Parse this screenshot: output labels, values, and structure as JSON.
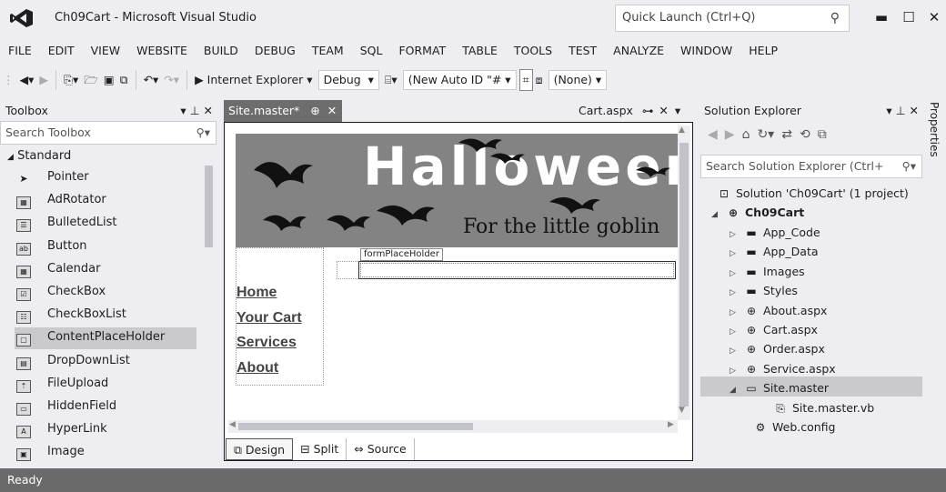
{
  "window": {
    "title": "Ch09Cart - Microsoft Visual Studio",
    "quick_launch": "Quick Launch (Ctrl+Q)"
  },
  "menu": [
    "FILE",
    "EDIT",
    "VIEW",
    "WEBSITE",
    "BUILD",
    "DEBUG",
    "TEAM",
    "SQL",
    "FORMAT",
    "TABLE",
    "TOOLS",
    "TEST",
    "ANALYZE",
    "WINDOW",
    "HELP"
  ],
  "toolbar": {
    "browser": "Internet Explorer",
    "config": "Debug",
    "auto_id": "(New Auto ID \"#",
    "none": "(None)"
  },
  "toolbox": {
    "title": "Toolbox",
    "search_placeholder": "Search Toolbox",
    "group": "Standard",
    "items": [
      {
        "label": "Pointer",
        "icon": "pointer-icon"
      },
      {
        "label": "AdRotator",
        "icon": "adrotator-icon"
      },
      {
        "label": "BulletedList",
        "icon": "bulleted-list-icon"
      },
      {
        "label": "Button",
        "icon": "button-icon"
      },
      {
        "label": "Calendar",
        "icon": "calendar-icon"
      },
      {
        "label": "CheckBox",
        "icon": "checkbox-icon"
      },
      {
        "label": "CheckBoxList",
        "icon": "checkbox-list-icon"
      },
      {
        "label": "ContentPlaceHolder",
        "icon": "content-placeholder-icon"
      },
      {
        "label": "DropDownList",
        "icon": "dropdown-list-icon"
      },
      {
        "label": "FileUpload",
        "icon": "file-upload-icon"
      },
      {
        "label": "HiddenField",
        "icon": "hidden-field-icon"
      },
      {
        "label": "HyperLink",
        "icon": "hyperlink-icon"
      },
      {
        "label": "Image",
        "icon": "image-icon"
      }
    ],
    "selected_index": 7
  },
  "editor": {
    "active_tab": "Site.master*",
    "other_tab": "Cart.aspx",
    "banner_title": "Halloween Su",
    "banner_subtitle": "For the little goblin",
    "nav_links": [
      "Home",
      "Your Cart",
      "Services",
      "About"
    ],
    "placeholder_label": "formPlaceHolder",
    "view_tabs": [
      "Design",
      "Split",
      "Source"
    ],
    "active_view": "Design"
  },
  "solution_explorer": {
    "title": "Solution Explorer",
    "search_placeholder": "Search Solution Explorer (Ctrl+",
    "solution": "Solution 'Ch09Cart' (1 project)",
    "project": "Ch09Cart",
    "items": [
      {
        "label": "App_Code",
        "icon": "folder-icon"
      },
      {
        "label": "App_Data",
        "icon": "folder-icon"
      },
      {
        "label": "Images",
        "icon": "folder-icon"
      },
      {
        "label": "Styles",
        "icon": "folder-icon"
      },
      {
        "label": "About.aspx",
        "icon": "web-page-icon"
      },
      {
        "label": "Cart.aspx",
        "icon": "web-page-icon"
      },
      {
        "label": "Order.aspx",
        "icon": "web-page-icon"
      },
      {
        "label": "Service.aspx",
        "icon": "web-page-icon"
      },
      {
        "label": "Site.master",
        "icon": "master-page-icon"
      }
    ],
    "child": "Site.master.vb",
    "last": "Web.config",
    "selected": "Site.master"
  },
  "properties_tab": "Properties",
  "status": "Ready"
}
